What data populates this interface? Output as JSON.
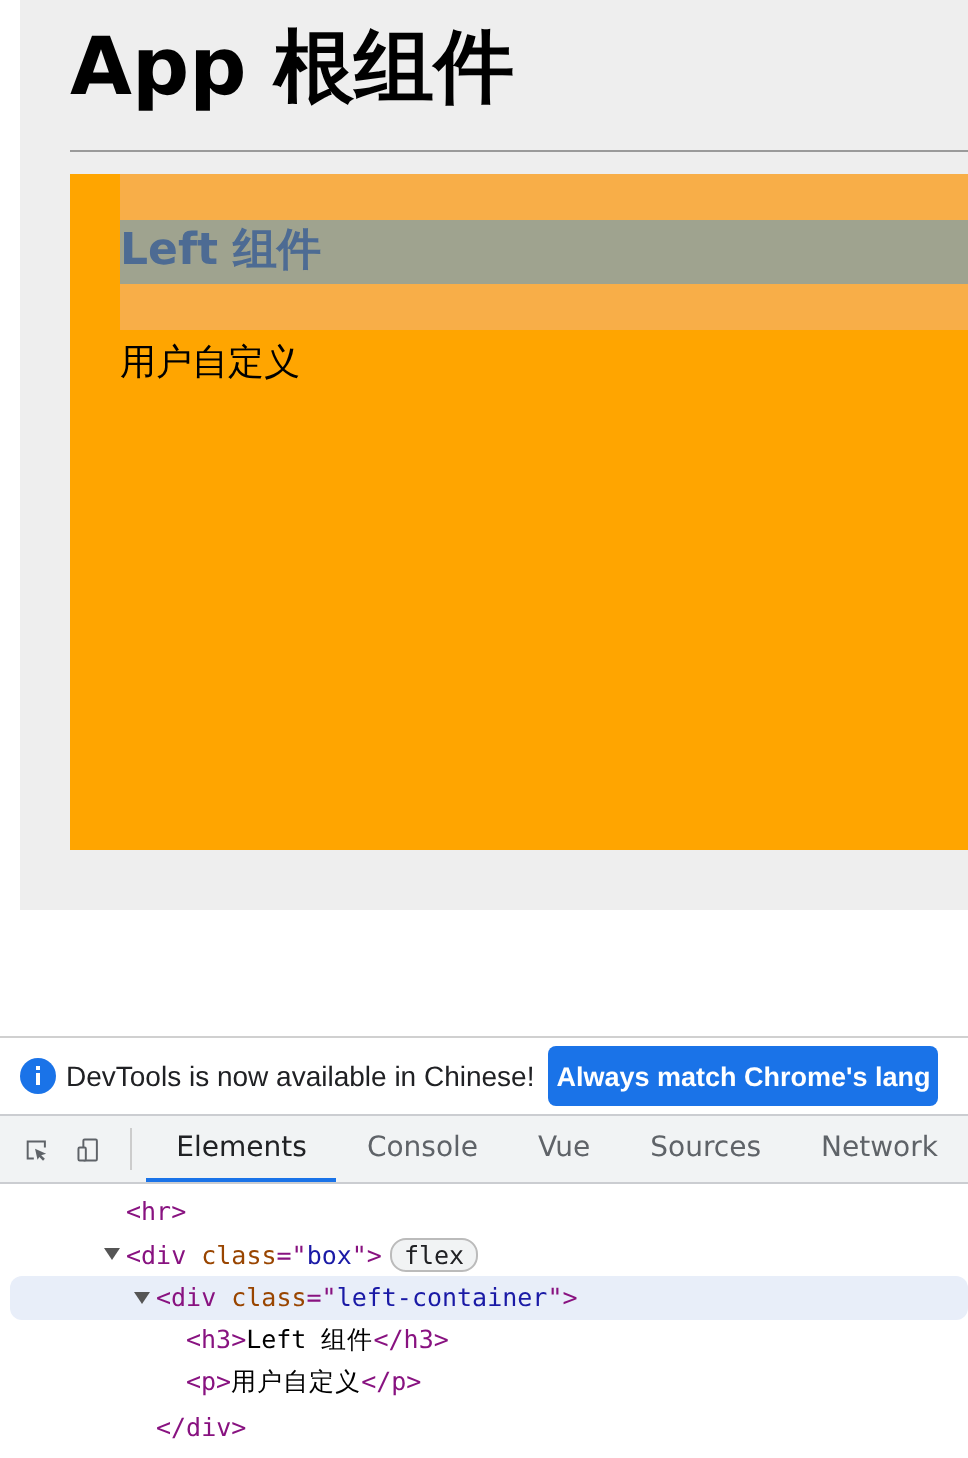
{
  "page": {
    "title": "App 根组件",
    "left": {
      "heading": "Left 组件",
      "text": "用户自定义"
    }
  },
  "devtools": {
    "infobar": {
      "message": "DevTools is now available in Chinese!",
      "button": "Always match Chrome's lang"
    },
    "tabs": [
      {
        "label": "Elements",
        "selected": true
      },
      {
        "label": "Console",
        "selected": false
      },
      {
        "label": "Vue",
        "selected": false
      },
      {
        "label": "Sources",
        "selected": false
      },
      {
        "label": "Network",
        "selected": false
      }
    ],
    "tree": [
      {
        "tokens": [
          {
            "kind": "tag",
            "text": "<hr>"
          }
        ]
      },
      {
        "expanded": true,
        "selected": false,
        "tokens": [
          {
            "kind": "tag",
            "text": "<div"
          },
          {
            "kind": "attr",
            "text": " class"
          },
          {
            "kind": "tag",
            "text": "=\""
          },
          {
            "kind": "value",
            "text": "box"
          },
          {
            "kind": "tag",
            "text": "\">"
          }
        ],
        "badge": "flex",
        "children": [
          {
            "expanded": true,
            "selected": true,
            "tokens": [
              {
                "kind": "tag",
                "text": "<div"
              },
              {
                "kind": "attr",
                "text": " class"
              },
              {
                "kind": "tag",
                "text": "=\""
              },
              {
                "kind": "value",
                "text": "left-container"
              },
              {
                "kind": "tag",
                "text": "\">"
              }
            ],
            "children": [
              {
                "tokens": [
                  {
                    "kind": "tag",
                    "text": "<h3>"
                  },
                  {
                    "kind": "text",
                    "text": "Left 组件"
                  },
                  {
                    "kind": "tag",
                    "text": "</h3>"
                  }
                ]
              },
              {
                "tokens": [
                  {
                    "kind": "tag",
                    "text": "<p>"
                  },
                  {
                    "kind": "text",
                    "text": "用户自定义"
                  },
                  {
                    "kind": "tag",
                    "text": "</p>"
                  }
                ]
              }
            ],
            "closing": [
              {
                "kind": "tag",
                "text": "</div>"
              }
            ]
          }
        ]
      }
    ]
  }
}
